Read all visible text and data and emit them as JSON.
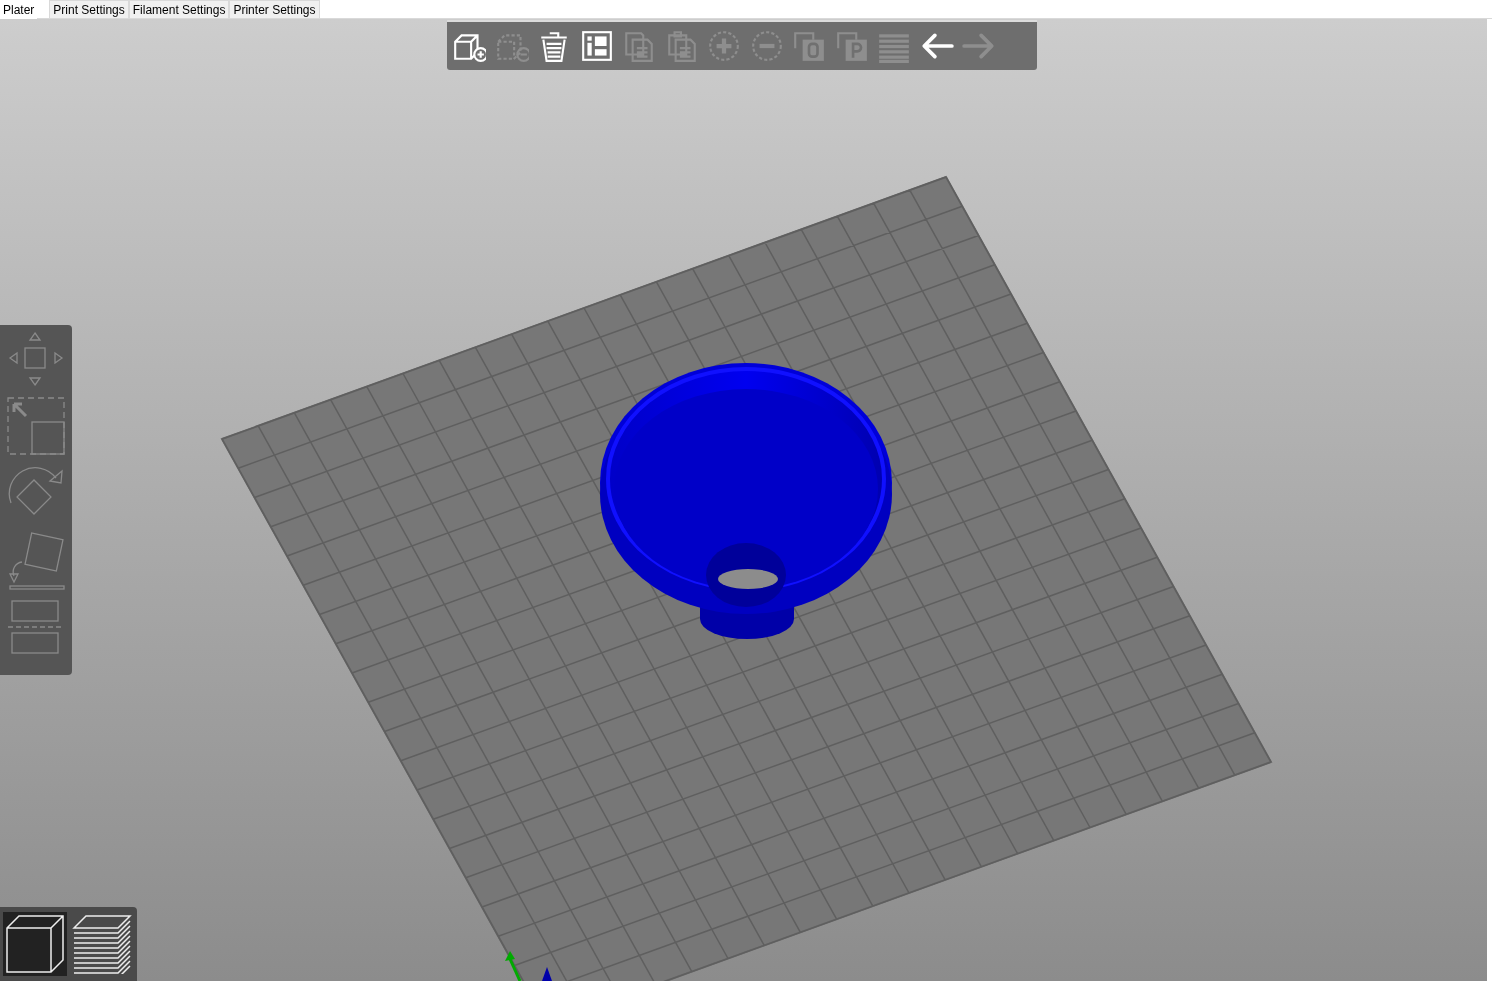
{
  "tabs": [
    {
      "label": "Plater",
      "selected": true
    },
    {
      "label": "Print Settings",
      "selected": false
    },
    {
      "label": "Filament Settings",
      "selected": false
    },
    {
      "label": "Printer Settings",
      "selected": false
    }
  ],
  "toolbar": [
    {
      "kind": "add",
      "disabled": false
    },
    {
      "kind": "remove",
      "disabled": true
    },
    {
      "kind": "delete",
      "disabled": false
    },
    {
      "kind": "arrange",
      "disabled": false
    },
    {
      "kind": "copy",
      "disabled": true
    },
    {
      "kind": "paste",
      "disabled": true
    },
    {
      "kind": "more",
      "disabled": true
    },
    {
      "kind": "fewer",
      "disabled": true
    },
    {
      "kind": "split-objects",
      "disabled": true
    },
    {
      "kind": "split-parts",
      "disabled": true
    },
    {
      "kind": "layers",
      "disabled": true
    },
    {
      "kind": "undo",
      "disabled": false
    },
    {
      "kind": "redo",
      "disabled": true
    }
  ],
  "gizmos": [
    {
      "kind": "move"
    },
    {
      "kind": "scale"
    },
    {
      "kind": "rotate"
    },
    {
      "kind": "place"
    },
    {
      "kind": "cut"
    }
  ],
  "views": [
    {
      "kind": "model",
      "selected": true
    },
    {
      "kind": "preview",
      "selected": false
    }
  ]
}
